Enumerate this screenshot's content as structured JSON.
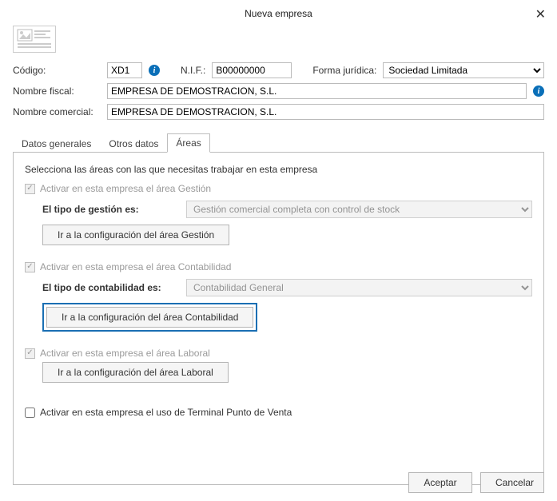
{
  "dialog": {
    "title": "Nueva empresa"
  },
  "fields": {
    "codigo_label": "Código:",
    "codigo_value": "XD1",
    "nif_label": "N.I.F.:",
    "nif_value": "B00000000",
    "forma_label": "Forma jurídica:",
    "forma_value": "Sociedad Limitada",
    "nombre_fiscal_label": "Nombre fiscal:",
    "nombre_fiscal_value": "EMPRESA DE DEMOSTRACION, S.L.",
    "nombre_comercial_label": "Nombre comercial:",
    "nombre_comercial_value": "EMPRESA DE DEMOSTRACION, S.L."
  },
  "tabs": {
    "t0": "Datos generales",
    "t1": "Otros datos",
    "t2": "Áreas"
  },
  "areas": {
    "intro": "Selecciona las áreas con las que necesitas trabajar en esta empresa",
    "gestion": {
      "chk": "Activar en esta empresa el área Gestión",
      "tipo_label": "El tipo de gestión es:",
      "tipo_value": "Gestión comercial completa con control de stock",
      "btn": "Ir a la configuración del área Gestión"
    },
    "contabilidad": {
      "chk": "Activar en esta empresa el área Contabilidad",
      "tipo_label": "El tipo de contabilidad es:",
      "tipo_value": "Contabilidad General",
      "btn": "Ir a la configuración del área Contabilidad"
    },
    "laboral": {
      "chk": "Activar en esta empresa el área Laboral",
      "btn": "Ir a la configuración del área Laboral"
    },
    "tpv": {
      "chk": "Activar en esta empresa el uso de Terminal Punto de Venta"
    }
  },
  "footer": {
    "accept": "Aceptar",
    "cancel": "Cancelar"
  }
}
